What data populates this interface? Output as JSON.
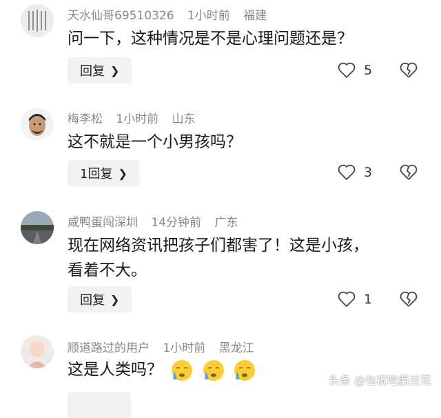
{
  "comments": [
    {
      "username": "天水仙哥69510326",
      "time": "1小时前",
      "location": "福建",
      "text": "问一下，这种情况是不是心理问题还是？",
      "reply_label": "回复",
      "likes": "5"
    },
    {
      "username": "梅李松",
      "time": "1小时前",
      "location": "山东",
      "text": "这不就是一个小男孩吗？",
      "reply_label": "1回复",
      "likes": "3"
    },
    {
      "username": "咸鸭蛋闯深圳",
      "time": "14分钟前",
      "location": "广东",
      "text_line1": "现在网络资讯把孩子们都害了！这是小孩，",
      "text_line2": "看着不大。",
      "reply_label": "回复",
      "likes": "1"
    },
    {
      "username": "顺道路过的用户",
      "time": "1小时前",
      "location": "黑龙江",
      "text": "这是人类吗？",
      "emojis": [
        "crying-emoji",
        "crying-emoji",
        "crying-emoji"
      ]
    }
  ],
  "watermark": "头条 @也祝吃西兰花",
  "colors": {
    "meta": "#888888",
    "reply_bg": "#f2f2f2",
    "text": "#1a1a1a"
  }
}
